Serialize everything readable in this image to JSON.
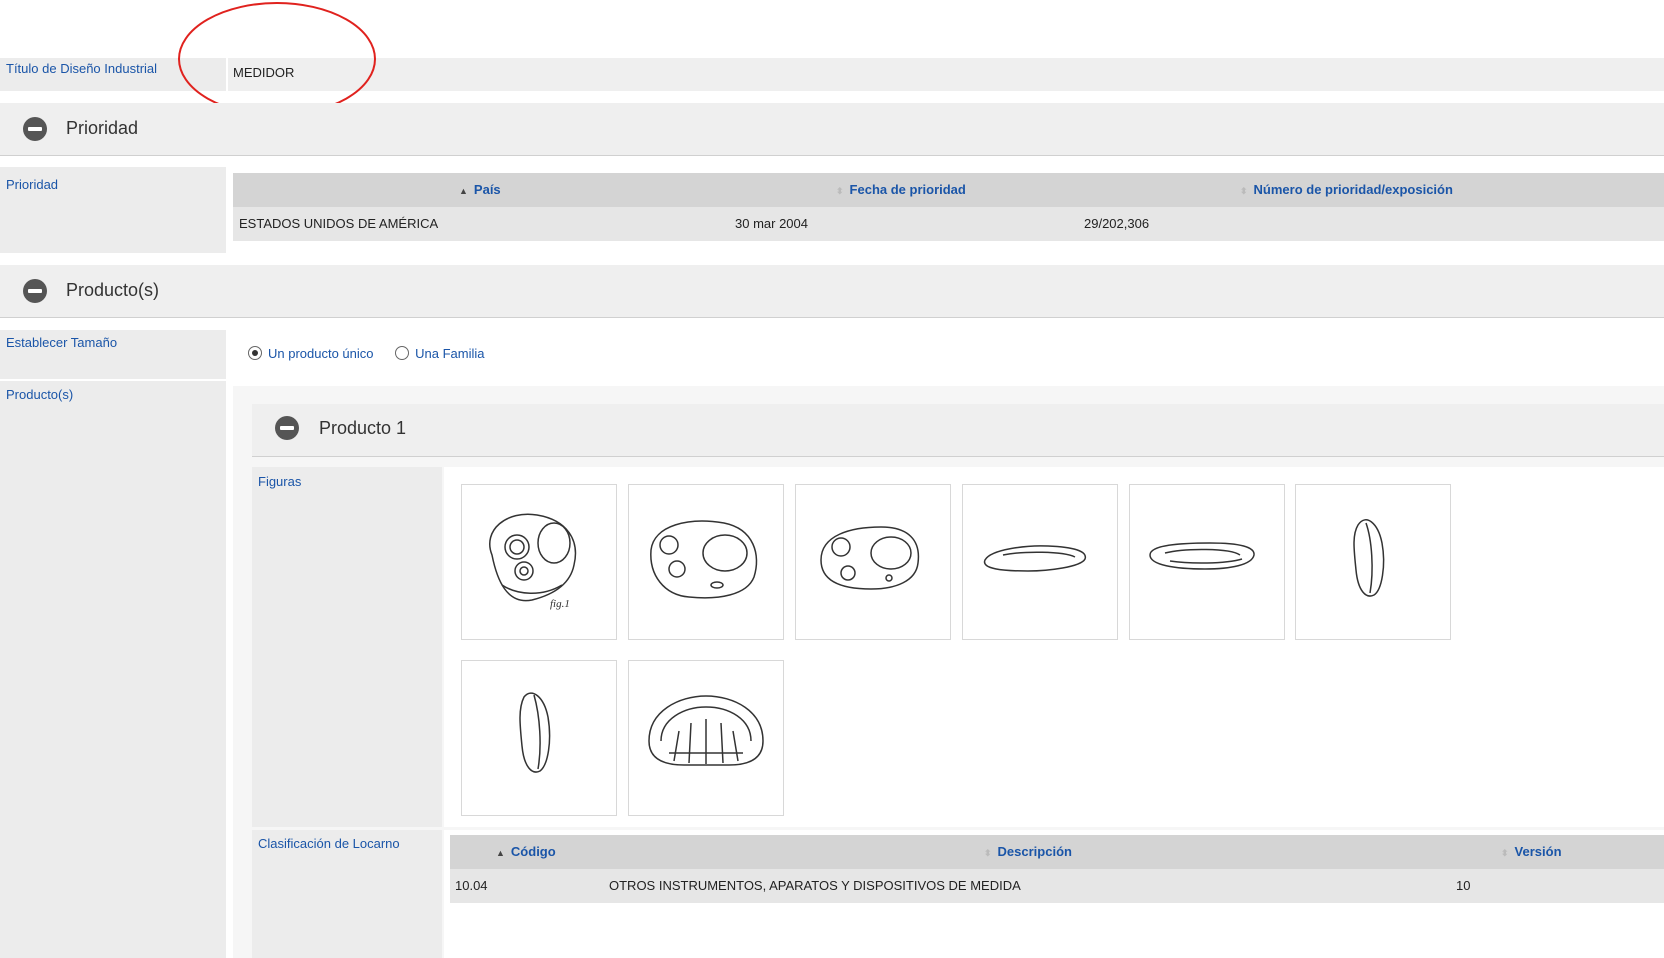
{
  "title_row": {
    "label": "Título de Diseño Industrial",
    "value": "MEDIDOR"
  },
  "priority_section": {
    "title": "Prioridad",
    "field_label": "Prioridad",
    "columns": [
      "País",
      "Fecha de prioridad",
      "Número de prioridad/exposición"
    ],
    "rows": [
      {
        "country": "ESTADOS UNIDOS DE AMÉRICA",
        "date": "30 mar 2004",
        "number": "29/202,306"
      }
    ]
  },
  "products_section": {
    "title": "Producto(s)",
    "size_label": "Establecer Tamaño",
    "options": [
      {
        "label": "Un producto único",
        "selected": true
      },
      {
        "label": "Una Familia",
        "selected": false
      }
    ],
    "products_label": "Producto(s)",
    "product": {
      "title": "Producto 1",
      "figures_label": "Figuras",
      "figure_icons": [
        "meter-front-icon",
        "meter-angle-icon",
        "meter-side-icon",
        "meter-flat-icon",
        "meter-edge-icon",
        "meter-profile-icon",
        "meter-profile-icon",
        "meter-back-icon"
      ],
      "fig1_caption": "fig.1",
      "locarno_label": "Clasificación de Locarno",
      "locarno_columns": [
        "Código",
        "Descripción",
        "Versión"
      ],
      "locarno_rows": [
        {
          "code": "10.04",
          "description": "OTROS INSTRUMENTOS, APARATOS Y DISPOSITIVOS DE MEDIDA",
          "version": "10"
        }
      ]
    }
  },
  "colors": {
    "link": "#1a55a8",
    "annotation": "#e0221e"
  }
}
